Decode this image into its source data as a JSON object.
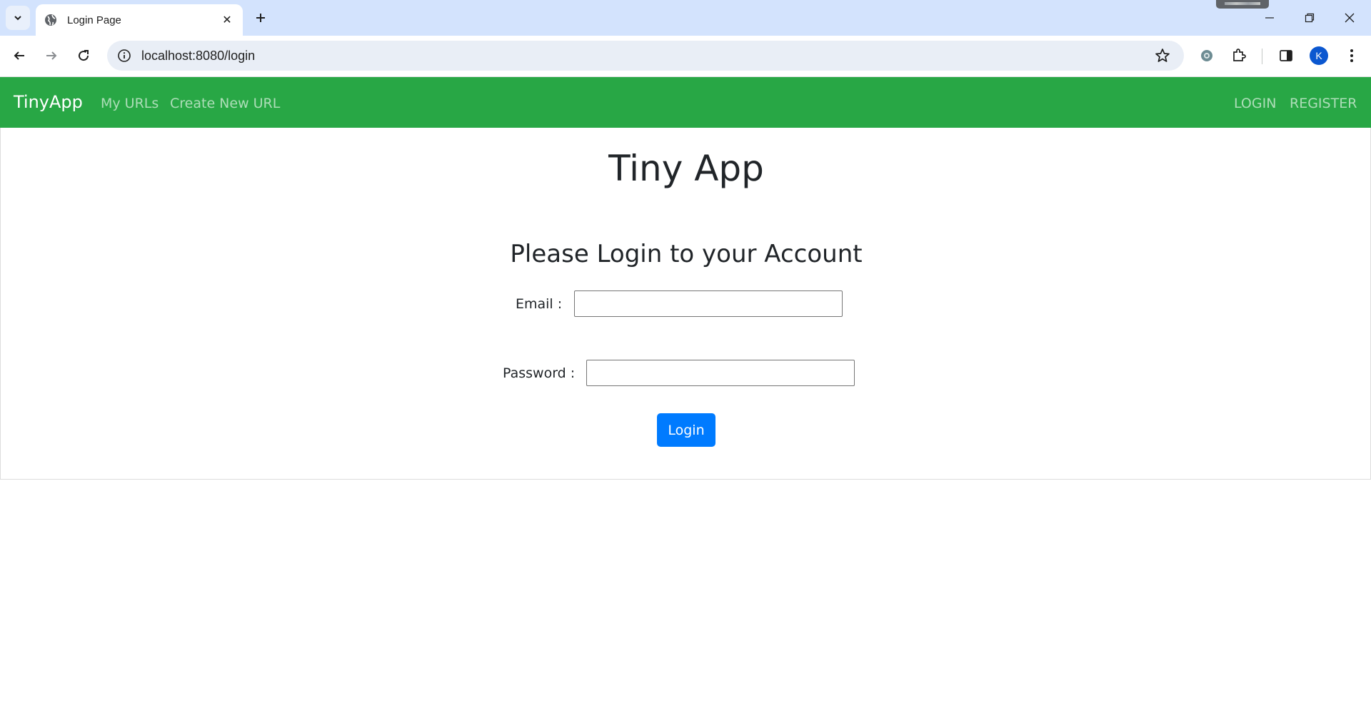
{
  "browser": {
    "tab_title": "Login Page",
    "url": "localhost:8080/login",
    "profile_initial": "K"
  },
  "nav": {
    "brand": "TinyApp",
    "links": [
      "My URLs",
      "Create New URL"
    ],
    "right_links": [
      "LOGIN",
      "REGISTER"
    ]
  },
  "main": {
    "title": "Tiny App",
    "subtitle": "Please Login to your Account",
    "email_label": "Email :",
    "email_value": "",
    "password_label": "Password :",
    "password_value": "",
    "login_button": "Login"
  },
  "colors": {
    "navbar": "#28a745",
    "button": "#007bff"
  }
}
